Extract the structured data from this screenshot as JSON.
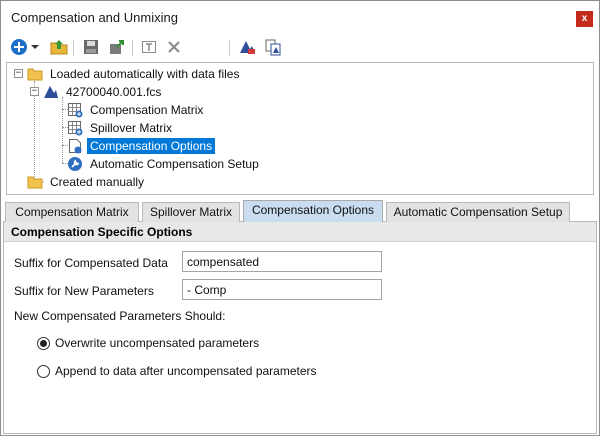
{
  "window": {
    "title": "Compensation and Unmixing",
    "close_glyph": "x"
  },
  "toolbar": {
    "buttons": [
      {
        "name": "add-icon"
      },
      {
        "name": "dropdown-arrow-icon"
      },
      {
        "name": "import-folder-icon"
      },
      {
        "name": "save-icon"
      },
      {
        "name": "export-icon"
      },
      {
        "name": "rename-icon"
      },
      {
        "name": "delete-icon"
      },
      {
        "name": "apply-icon"
      },
      {
        "name": "copy-icon"
      }
    ]
  },
  "tree": {
    "nodes": [
      {
        "label": "Loaded automatically with data files"
      },
      {
        "label": "42700040.001.fcs"
      },
      {
        "label": "Compensation Matrix"
      },
      {
        "label": "Spillover Matrix"
      },
      {
        "label": "Compensation Options"
      },
      {
        "label": "Automatic Compensation Setup"
      },
      {
        "label": "Created manually"
      }
    ],
    "expander_minus": "−"
  },
  "tabs": [
    {
      "label": "Compensation Matrix"
    },
    {
      "label": "Spillover Matrix"
    },
    {
      "label": "Compensation Options"
    },
    {
      "label": "Automatic Compensation Setup"
    }
  ],
  "panel": {
    "header": "Compensation Specific Options",
    "suffix_compensated_label": "Suffix for Compensated Data",
    "suffix_compensated_value": "compensated",
    "suffix_new_params_label": "Suffix for New Parameters",
    "suffix_new_params_value": "- Comp",
    "new_params_label": "New Compensated Parameters Should:",
    "radio_overwrite": "Overwrite uncompensated parameters",
    "radio_append": "Append to data after uncompensated parameters"
  }
}
